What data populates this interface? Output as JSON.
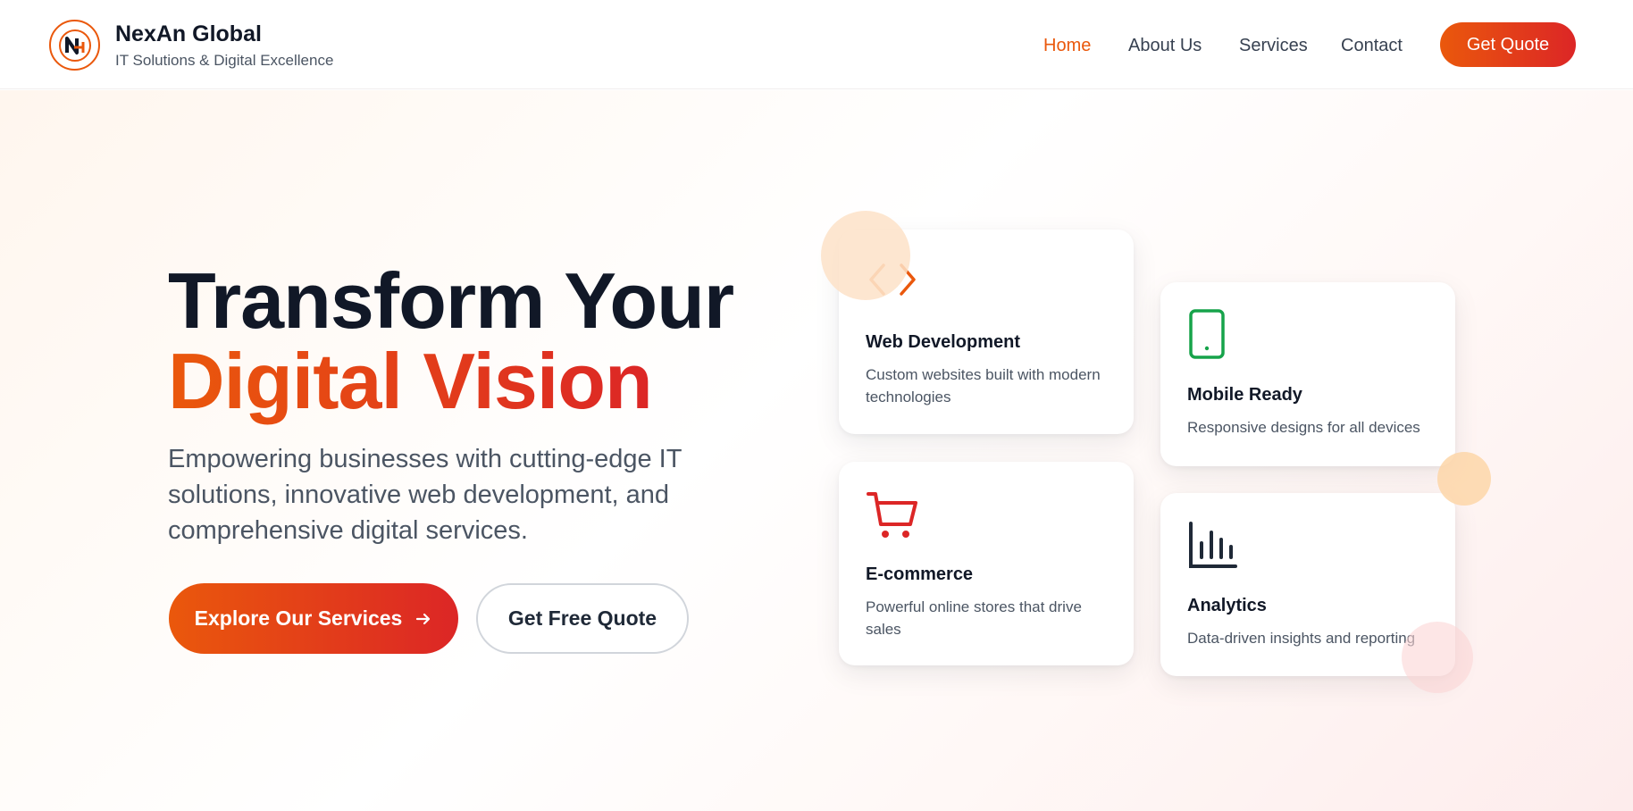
{
  "brand": {
    "name": "NexAn Global",
    "tagline": "IT Solutions & Digital Excellence",
    "logo_icon": "nexan-logo-icon"
  },
  "nav": {
    "items": [
      {
        "label": "Home",
        "active": true
      },
      {
        "label": "About Us",
        "active": false
      },
      {
        "label": "Services",
        "active": false
      },
      {
        "label": "Contact",
        "active": false
      }
    ],
    "cta_label": "Get Quote"
  },
  "hero": {
    "title_line1": "Transform Your",
    "title_line2": "Digital Vision",
    "subtitle": "Empowering businesses with cutting-edge IT solutions, innovative web development, and comprehensive digital services.",
    "primary_cta": "Explore Our Services",
    "primary_cta_icon": "arrow-right-icon",
    "secondary_cta": "Get Free Quote"
  },
  "features": [
    {
      "title": "Web Development",
      "description": "Custom websites built with modern technologies",
      "icon": "code-icon",
      "color": "#ea580c"
    },
    {
      "title": "Mobile Ready",
      "description": "Responsive designs for all devices",
      "icon": "mobile-icon",
      "color": "#16a34a"
    },
    {
      "title": "E-commerce",
      "description": "Powerful online stores that drive sales",
      "icon": "cart-icon",
      "color": "#dc2626"
    },
    {
      "title": "Analytics",
      "description": "Data-driven insights and reporting",
      "icon": "bar-chart-icon",
      "color": "#1f2937"
    }
  ],
  "colors": {
    "accent": "#ea580c",
    "accent_end": "#dc2626",
    "text_dark": "#111827",
    "text_muted": "#4b5563"
  }
}
